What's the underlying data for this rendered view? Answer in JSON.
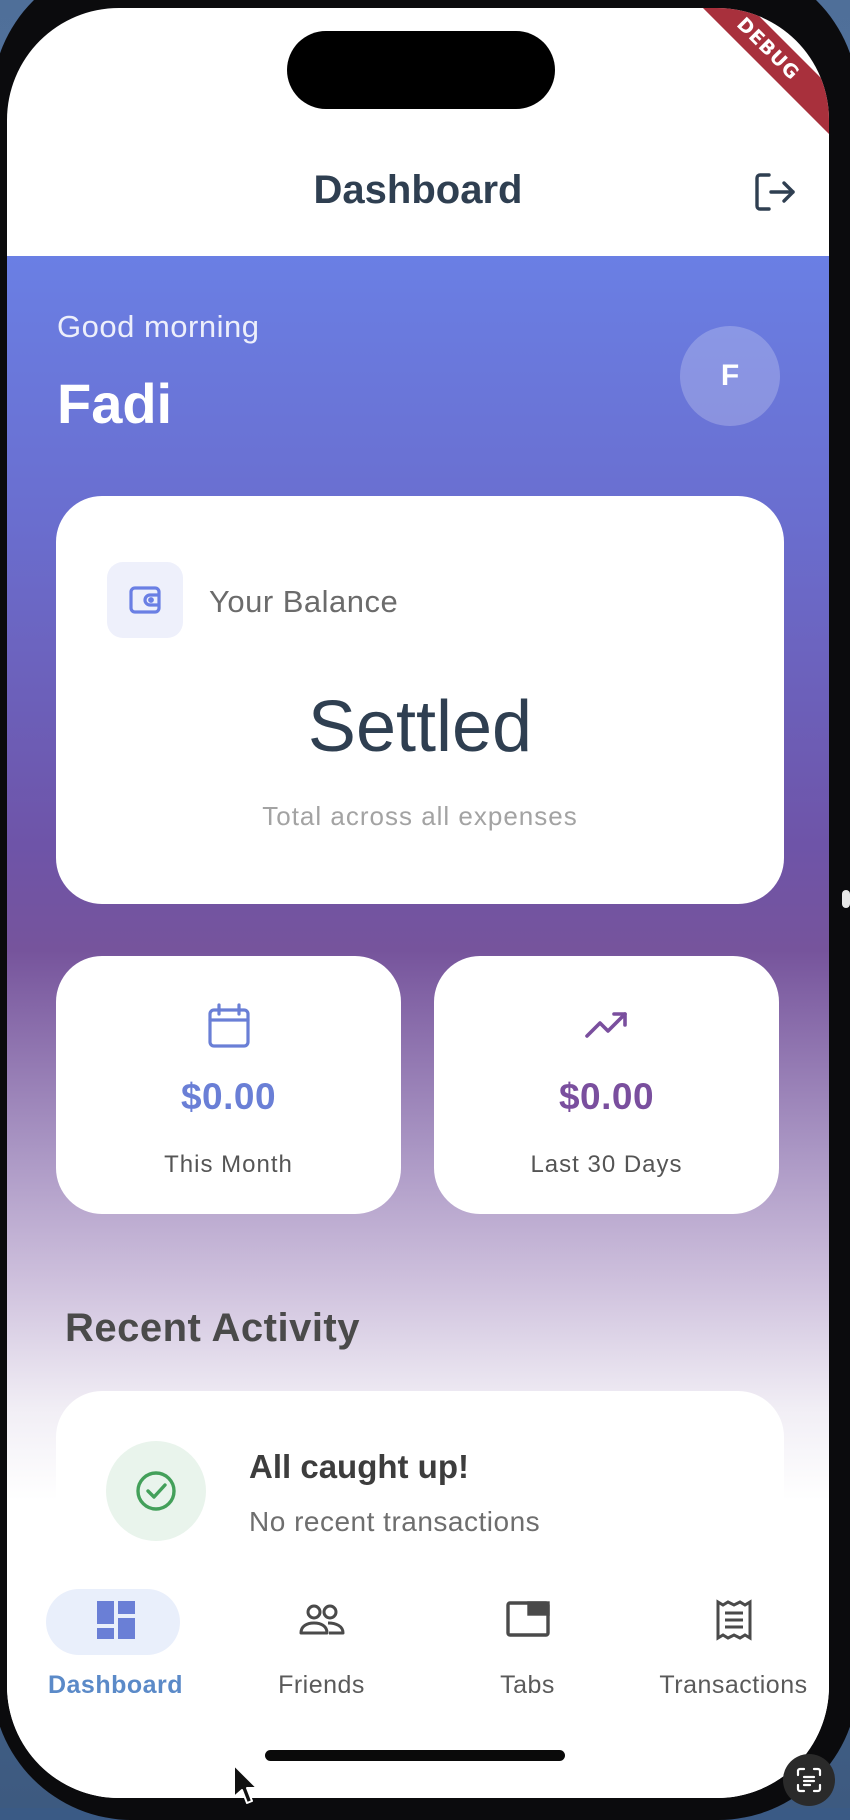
{
  "debug_ribbon": "DEBUG",
  "appbar": {
    "title": "Dashboard"
  },
  "hero": {
    "greeting": "Good morning",
    "name": "Fadi",
    "avatar_initial": "F"
  },
  "balance": {
    "label": "Your Balance",
    "value": "Settled",
    "subtitle": "Total across all expenses"
  },
  "stats": [
    {
      "value": "$0.00",
      "label": "This Month",
      "icon": "calendar-icon",
      "color": "#6a7fd6"
    },
    {
      "value": "$0.00",
      "label": "Last 30 Days",
      "icon": "trending-up-icon",
      "color": "#7a4f9e"
    }
  ],
  "recent": {
    "title": "Recent Activity",
    "empty_title": "All caught up!",
    "empty_subtitle": "No recent transactions"
  },
  "nav": {
    "items": [
      {
        "label": "Dashboard",
        "icon": "dashboard-icon",
        "active": true
      },
      {
        "label": "Friends",
        "icon": "friends-icon",
        "active": false
      },
      {
        "label": "Tabs",
        "icon": "tabs-icon",
        "active": false
      },
      {
        "label": "Transactions",
        "icon": "receipt-icon",
        "active": false
      }
    ]
  },
  "colors": {
    "accent": "#6a7fe4",
    "purple": "#76549c",
    "nav_active": "#5b8ac8",
    "success": "#43a05a"
  }
}
